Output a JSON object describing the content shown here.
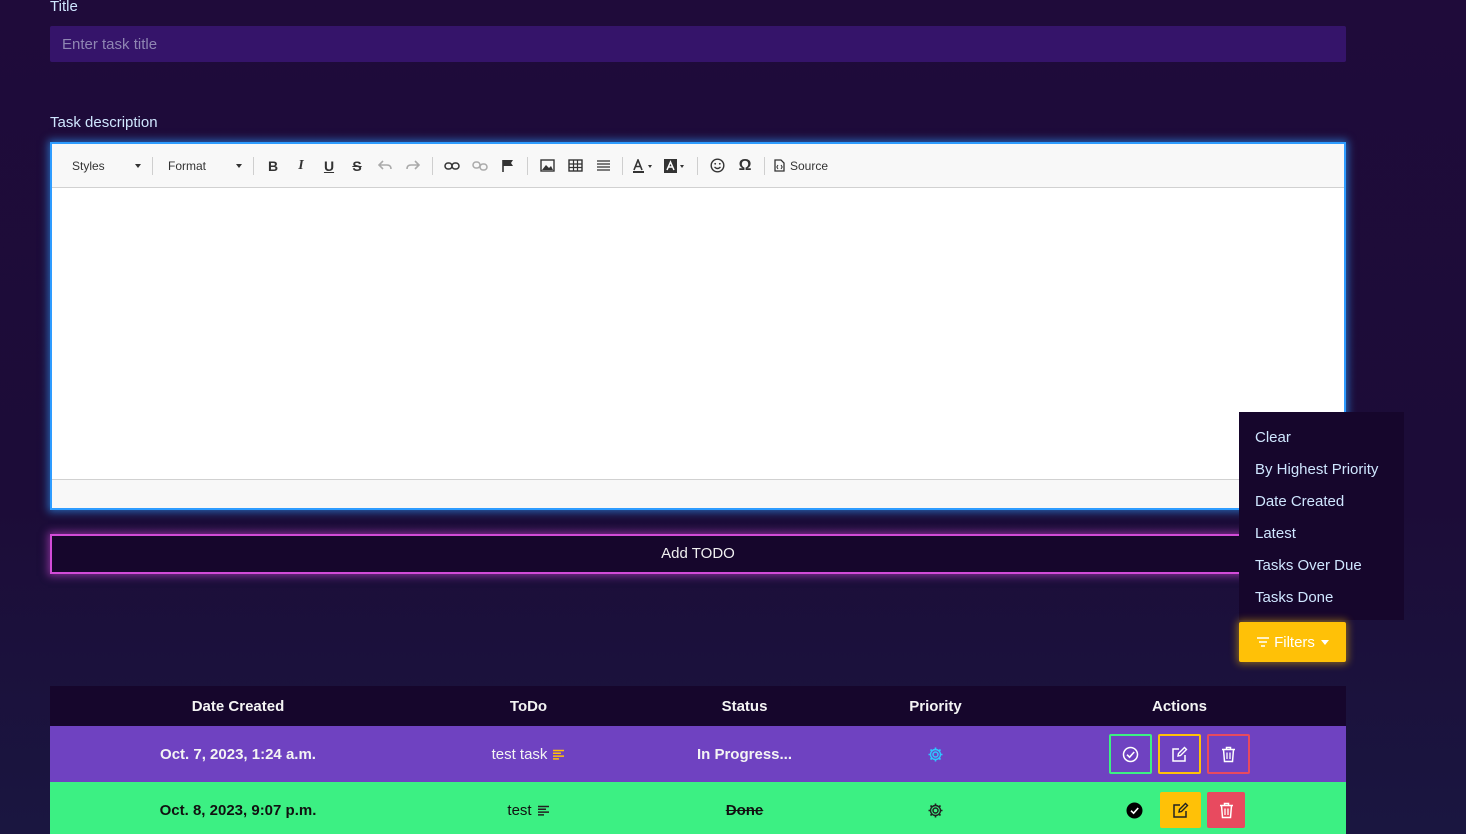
{
  "form": {
    "title_label": "Title",
    "title_placeholder": "Enter task title",
    "description_label": "Task description",
    "add_button": "Add TODO"
  },
  "editor": {
    "styles_label": "Styles",
    "format_label": "Format",
    "bold": "B",
    "italic": "I",
    "underline": "U",
    "strike": "S",
    "special_char": "Ω",
    "source_label": "Source"
  },
  "filters": {
    "button_label": "Filters",
    "options": [
      "Clear",
      "By Highest Priority",
      "Date Created",
      "Latest",
      "Tasks Over Due",
      "Tasks Done"
    ]
  },
  "table": {
    "headers": [
      "Date Created",
      "ToDo",
      "Status",
      "Priority",
      "Actions"
    ],
    "rows": [
      {
        "date": "Oct. 7, 2023, 1:24 a.m.",
        "todo": "test task",
        "status": "In Progress...",
        "priority_icon": "gear-icon"
      },
      {
        "date": "Oct. 8, 2023, 9:07 p.m.",
        "todo": "test",
        "status": "Done",
        "priority_icon": "gear-icon"
      }
    ]
  },
  "colors": {
    "row_in_progress": "#6f42c1",
    "row_done": "#3cf083",
    "filters_button": "#ffc107",
    "editor_border": "#2e9cff",
    "add_button_border": "#d24bd8"
  }
}
